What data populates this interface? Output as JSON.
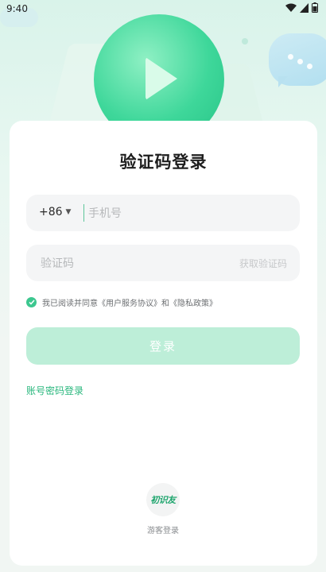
{
  "status_bar": {
    "time": "9:40"
  },
  "login": {
    "title": "验证码登录",
    "country_code": "+86",
    "phone_placeholder": "手机号",
    "code_placeholder": "验证码",
    "get_code_label": "获取验证码",
    "agreement_text": "我已阅读并同意《用户服务协议》和《隐私政策》",
    "submit_label": "登录",
    "password_login_link": "账号密码登录",
    "visitor_logo_text": "初识友",
    "visitor_label": "游客登录"
  },
  "colors": {
    "accent": "#29b77d",
    "button_disabled": "#bdeed8",
    "field_bg": "#f4f5f6",
    "page_bg": "#e8f7f1"
  },
  "icons": {
    "status": [
      "wifi-icon",
      "signal-icon",
      "battery-icon"
    ],
    "hero": "play-icon",
    "chat": "chat-bubble-icon",
    "agree": "check-circle-icon",
    "dropdown": "caret-down-icon"
  }
}
